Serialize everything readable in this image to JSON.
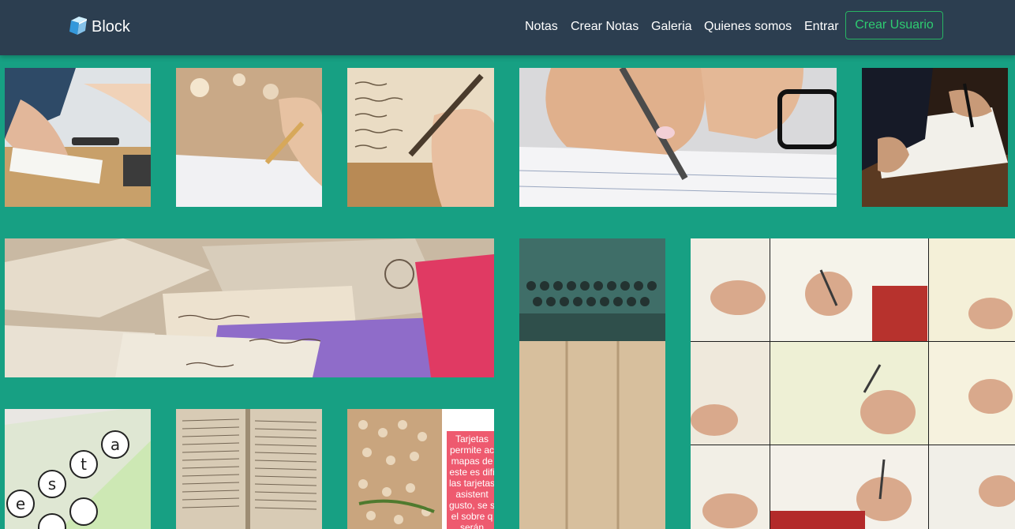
{
  "navbar": {
    "brand": "Block",
    "links": [
      "Notas",
      "Crear Notas",
      "Galeria",
      "Quienes somos",
      "Entrar"
    ],
    "cta": "Crear Usuario"
  },
  "gallery": {
    "card_text": "Tarjetas\npermite ac\nmapas de\neste es difi\nlas tarjetas\nasistent\ngusto, se s\nel sobre q\nserán"
  }
}
